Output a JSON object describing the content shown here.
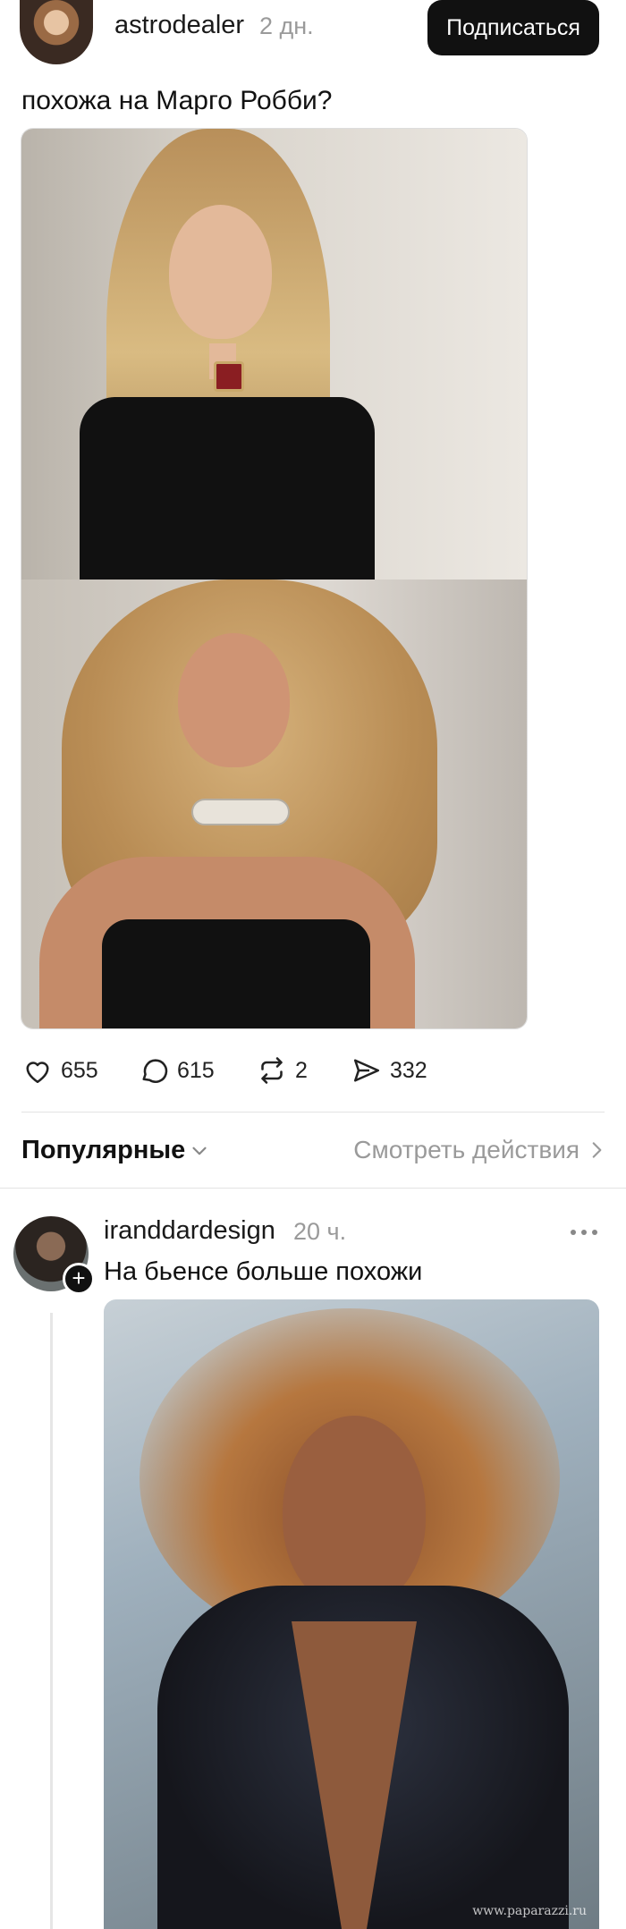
{
  "post": {
    "username": "astrodealer",
    "time": "2 дн.",
    "subscribe_label": "Подписаться",
    "text": "похожа на Марго Робби?"
  },
  "actions": {
    "likes": "655",
    "replies": "615",
    "reposts": "2",
    "shares": "332"
  },
  "sort": {
    "label": "Популярные",
    "view_actions": "Смотреть действия"
  },
  "reply": {
    "username": "iranddardesign",
    "time": "20 ч.",
    "text": "На бьенсе больше похожи",
    "watermark": "www.paparazzi.ru"
  },
  "icons": {
    "like": "heart-icon",
    "reply": "speech-bubble-icon",
    "repost": "repost-icon",
    "share": "send-icon",
    "more": "more-dots-icon",
    "chevron": "chevron-down-icon",
    "arrow": "chevron-right-icon",
    "plus": "plus-icon"
  },
  "colors": {
    "text": "#111111",
    "muted": "#9a9a9a",
    "button": "#111111",
    "divider": "#e3e3e3"
  }
}
